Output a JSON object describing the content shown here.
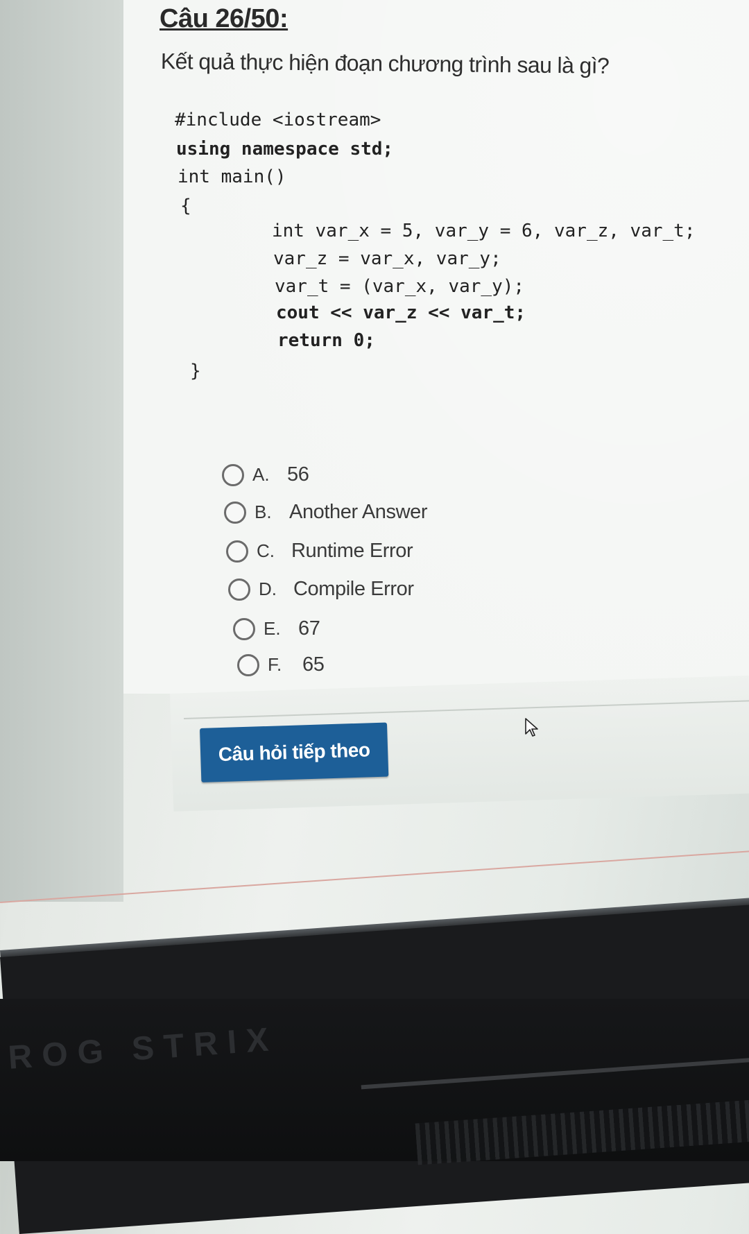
{
  "question": {
    "title": "Câu 26/50:",
    "prompt": "Kết quả thực hiện đoạn chương trình sau là gì?"
  },
  "code_lines": [
    "#include <iostream>",
    "using namespace std;",
    "int main()",
    "{",
    "int var_x = 5, var_y = 6, var_z, var_t;",
    "var_z = var_x, var_y;",
    "var_t = (var_x, var_y);",
    "cout << var_z << var_t;",
    "return 0;",
    "}"
  ],
  "answers": [
    {
      "letter": "A.",
      "text": "56"
    },
    {
      "letter": "B.",
      "text": "Another Answer"
    },
    {
      "letter": "C.",
      "text": "Runtime Error"
    },
    {
      "letter": "D.",
      "text": "Compile Error"
    },
    {
      "letter": "E.",
      "text": "67"
    },
    {
      "letter": "F.",
      "text": "65"
    }
  ],
  "next_button": {
    "label": "Câu hỏi tiếp theo"
  },
  "laptop": {
    "brand": "ROG STRIX"
  },
  "colors": {
    "button": "#1d5f98",
    "screen": "#eef1ee",
    "bezel": "#1a1b1d"
  }
}
